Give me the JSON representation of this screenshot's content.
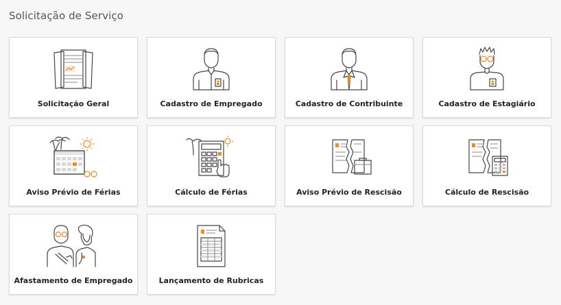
{
  "page": {
    "title": "Solicitação de Serviço"
  },
  "cards": [
    {
      "label": "Solicitação Geral",
      "icon": "documents-icon"
    },
    {
      "label": "Cadastro de Empregado",
      "icon": "employee-icon"
    },
    {
      "label": "Cadastro de Contribuinte",
      "icon": "contributor-icon"
    },
    {
      "label": "Cadastro de Estagiário",
      "icon": "intern-icon"
    },
    {
      "label": "Aviso Prévio de Férias",
      "icon": "vacation-calendar-icon"
    },
    {
      "label": "Cálculo de Férias",
      "icon": "vacation-calculator-icon"
    },
    {
      "label": "Aviso Prévio de Rescisão",
      "icon": "torn-contract-icon"
    },
    {
      "label": "Cálculo de Rescisão",
      "icon": "torn-contract-calculator-icon"
    },
    {
      "label": "Afastamento de Empregado",
      "icon": "employee-leave-icon"
    },
    {
      "label": "Lançamento de Rubricas",
      "icon": "payroll-document-icon"
    }
  ],
  "colors": {
    "accent": "#f08a24",
    "line": "#444444",
    "background": "#f7f7f7"
  }
}
